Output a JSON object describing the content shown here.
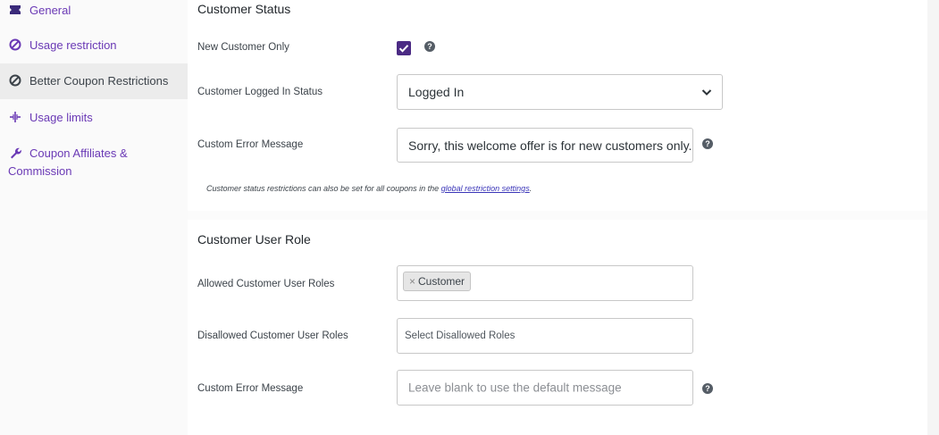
{
  "sidebar": {
    "items": [
      {
        "label": "General",
        "icon": "ticket-icon",
        "active": false
      },
      {
        "label": "Usage restriction",
        "icon": "block-icon",
        "active": false
      },
      {
        "label": "Better Coupon Restrictions",
        "icon": "block-icon",
        "active": true
      },
      {
        "label": "Usage limits",
        "icon": "plus-minus-icon",
        "active": false
      },
      {
        "label_line1": "Coupon Affiliates &",
        "label_line2": "Commission",
        "icon": "wrench-icon",
        "active": false
      }
    ]
  },
  "customer_status": {
    "title": "Customer Status",
    "new_customer_only": {
      "label": "New Customer Only",
      "checked": true,
      "help_icon": "?"
    },
    "logged_in_status": {
      "label": "Customer Logged In Status",
      "value": "Logged In"
    },
    "custom_error": {
      "label": "Custom Error Message",
      "value": "Sorry, this welcome offer is for new customers only.",
      "help_icon": "?"
    },
    "note": {
      "prefix": "Customer status restrictions can also be set for all coupons in the ",
      "link": "global restriction settings",
      "suffix": "."
    }
  },
  "customer_user_role": {
    "title": "Customer User Role",
    "allowed": {
      "label": "Allowed Customer User Roles",
      "tags": [
        "Customer"
      ],
      "tag_remove": "×"
    },
    "disallowed": {
      "label": "Disallowed Customer User Roles",
      "placeholder": "Select Disallowed Roles"
    },
    "custom_error": {
      "label": "Custom Error Message",
      "placeholder": "Leave blank to use the default message",
      "help_icon": "?"
    }
  },
  "colors": {
    "accent": "#6a39b5",
    "checkbox": "#4b2a84",
    "link": "#3a35b8",
    "active_nav_bg": "#ececec"
  }
}
